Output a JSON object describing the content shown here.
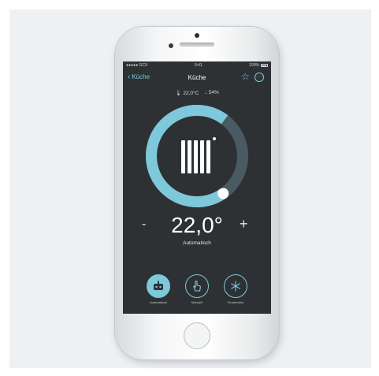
{
  "status_bar": {
    "carrier": "●●●●● GCX",
    "time": "9:41",
    "battery": "100%"
  },
  "nav": {
    "back_label": "Küche",
    "title": "Küche"
  },
  "readings": {
    "temperature": "22,0°C",
    "humidity": "54%"
  },
  "thermostat": {
    "set_temperature": "22,0°",
    "mode_label": "Automatisch",
    "minus_label": "-",
    "plus_label": "+",
    "dial_level": 0.7
  },
  "modes": [
    {
      "label": "Automatisch",
      "icon": "robot-icon",
      "active": true
    },
    {
      "label": "Manuell",
      "icon": "hand-icon",
      "active": false
    },
    {
      "label": "Frostschutz",
      "icon": "snowflake-icon",
      "active": false
    }
  ],
  "colors": {
    "accent": "#7ec8dc",
    "screen_bg": "#2e3134",
    "track": "#4a5a63"
  }
}
